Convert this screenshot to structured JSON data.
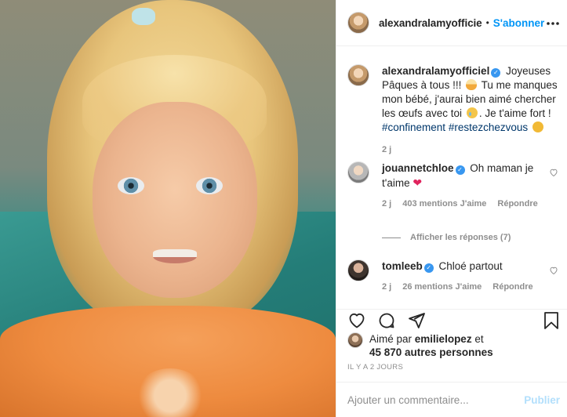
{
  "header": {
    "username": "alexandralamyofficie",
    "separator": "•",
    "follow_label": "S'abonner",
    "more_icon": "more-horizontal-icon"
  },
  "caption": {
    "username": "alexandralamyofficiel",
    "text_part1": "Joyeuses Pâques à tous !!!",
    "text_part2": "Tu me manques mon bébé, j'aurai bien aimé chercher les œufs avec toi",
    "text_part3": ". Je t'aime fort !",
    "hashtags": [
      "#confinement",
      "#restezchezvous"
    ],
    "time": "2 j"
  },
  "comments": [
    {
      "username": "jouannetchloe",
      "text": "Oh maman je t'aime",
      "time": "2 j",
      "likes": "403 mentions J'aime",
      "reply_label": "Répondre",
      "view_replies": "Afficher les réponses (7)"
    },
    {
      "username": "tomleeb",
      "text": "Chloé partout",
      "time": "2 j",
      "likes": "26 mentions J'aime",
      "reply_label": "Répondre"
    }
  ],
  "actions": {
    "like_icon": "heart-icon",
    "comment_icon": "comment-icon",
    "share_icon": "share-icon",
    "save_icon": "bookmark-icon"
  },
  "likes": {
    "prefix": "Aimé par",
    "user": "emilielopez",
    "joiner": "et",
    "others": "45 870 autres personnes"
  },
  "timestamp": "IL Y A 2 JOURS",
  "add_comment": {
    "placeholder": "Ajouter un commentaire...",
    "publish_label": "Publier"
  },
  "colors": {
    "accent": "#0095f6",
    "publish_disabled": "#b2dffc",
    "secondary_text": "#8e8e8e",
    "hashtag": "#00376b"
  }
}
